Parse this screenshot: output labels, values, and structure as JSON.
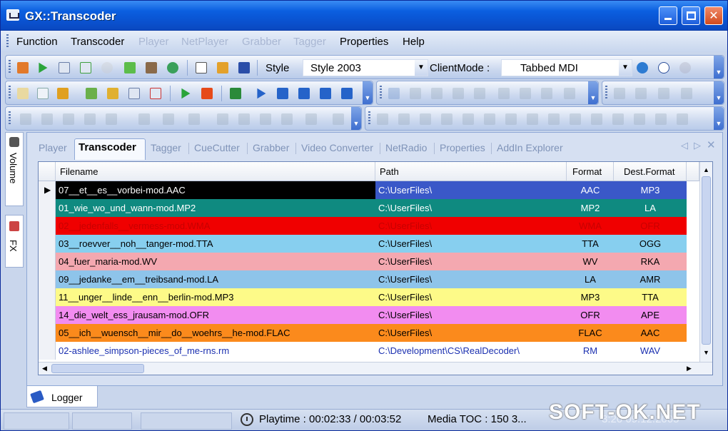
{
  "window": {
    "title": "GX::Transcoder"
  },
  "menu": [
    {
      "label": "Function",
      "enabled": true
    },
    {
      "label": "Transcoder",
      "enabled": true
    },
    {
      "label": "Player",
      "enabled": false
    },
    {
      "label": "NetPlayer",
      "enabled": false
    },
    {
      "label": "Grabber",
      "enabled": false
    },
    {
      "label": "Tagger",
      "enabled": false
    },
    {
      "label": "Properties",
      "enabled": true
    },
    {
      "label": "Help",
      "enabled": true
    }
  ],
  "toolbar": {
    "style_label": "Style",
    "style_value": "Style 2003",
    "clientmode_label": "ClientMode :",
    "clientmode_value": "Tabbed MDI"
  },
  "side_tabs": [
    "Volume",
    "FX"
  ],
  "doc_tabs": [
    "Player",
    "Transcoder",
    "Tagger",
    "CueCutter",
    "Grabber",
    "Video Converter",
    "NetRadio",
    "Properties",
    "AddIn Explorer"
  ],
  "active_tab": "Transcoder",
  "grid": {
    "columns": [
      "Filename",
      "Path",
      "Format",
      "Dest.Format"
    ],
    "rows": [
      {
        "filename": "07__et__es__vorbei-mod.AAC",
        "path": "C:\\UserFiles\\",
        "format": "AAC",
        "dest": "MP3",
        "bg": "#000000",
        "fg": "#ffffff",
        "pbg": "#3a58c8",
        "pfg": "#ffffff",
        "current": true
      },
      {
        "filename": "01_wie_wo_und_wann-mod.MP2",
        "path": "C:\\UserFiles\\",
        "format": "MP2",
        "dest": "LA",
        "bg": "#0f8a80",
        "fg": "#ffffff",
        "pbg": "#0f8a80",
        "pfg": "#ffffff"
      },
      {
        "filename": "02__jedenfalls__vermess-mod.WMA",
        "path": "C:\\UserFiles\\",
        "format": "WMA",
        "dest": "OFR",
        "bg": "#f00000",
        "fg": "#c80000",
        "pbg": "#f00000",
        "pfg": "#c80000"
      },
      {
        "filename": "03__roevver__noh__tanger-mod.TTA",
        "path": "C:\\UserFiles\\",
        "format": "TTA",
        "dest": "OGG",
        "bg": "#87cfef",
        "fg": "#000000",
        "pbg": "#87cfef",
        "pfg": "#000000"
      },
      {
        "filename": "04_fuer_maria-mod.WV",
        "path": "C:\\UserFiles\\",
        "format": "WV",
        "dest": "RKA",
        "bg": "#f4a8b0",
        "fg": "#000000",
        "pbg": "#f4a8b0",
        "pfg": "#000000"
      },
      {
        "filename": "09__jedanke__em__treibsand-mod.LA",
        "path": "C:\\UserFiles\\",
        "format": "LA",
        "dest": "AMR",
        "bg": "#8ec4ea",
        "fg": "#000000",
        "pbg": "#8ec4ea",
        "pfg": "#000000"
      },
      {
        "filename": "11__unger__linde__enn__berlin-mod.MP3",
        "path": "C:\\UserFiles\\",
        "format": "MP3",
        "dest": "TTA",
        "bg": "#fdfa88",
        "fg": "#000000",
        "pbg": "#fdfa88",
        "pfg": "#000000"
      },
      {
        "filename": "14_die_welt_ess_jrausam-mod.OFR",
        "path": "C:\\UserFiles\\",
        "format": "OFR",
        "dest": "APE",
        "bg": "#f28cf0",
        "fg": "#000000",
        "pbg": "#f28cf0",
        "pfg": "#000000"
      },
      {
        "filename": "05__ich__wuensch__mir__do__woehrs__he-mod.FLAC",
        "path": "C:\\UserFiles\\",
        "format": "FLAC",
        "dest": "AAC",
        "bg": "#fb8a1c",
        "fg": "#000000",
        "pbg": "#fb8a1c",
        "pfg": "#000000"
      },
      {
        "filename": "02-ashlee_simpson-pieces_of_me-rns.rm",
        "path": "C:\\Development\\CS\\RealDecoder\\",
        "format": "RM",
        "dest": "WAV",
        "bg": "#ffffff",
        "fg": "#1a2fb0",
        "pbg": "#ffffff",
        "pfg": "#1a2fb0"
      }
    ]
  },
  "logger": {
    "label": "Logger"
  },
  "status": {
    "playtime": "Playtime : 00:02:33 / 00:03:52",
    "media_toc": "Media TOC : 150 3...",
    "clock": "3:20 09.12.2005"
  },
  "watermark": "SOFT-OK.NET"
}
